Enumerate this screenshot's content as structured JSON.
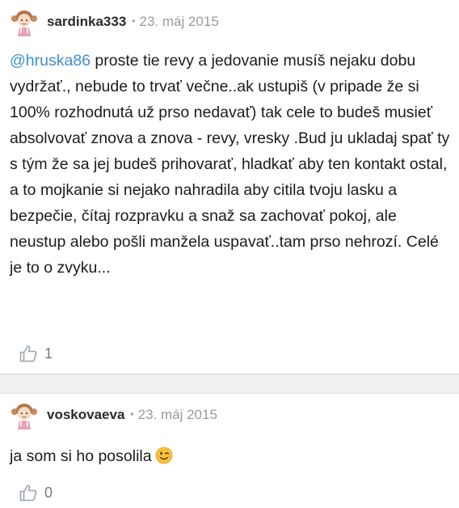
{
  "comments": [
    {
      "author": "sardinka333",
      "separator": "•",
      "date": "23. máj 2015",
      "mention": "@hruska86",
      "text": " proste tie revy a jedovanie musíš nejaku dobu vydržať., nebude to trvať večne..ak ustupiš (v pripade že si 100% rozhodnutá už prso nedavať) tak cele to budeš musieť absolvovať znova a znova - revy, vresky .Bud ju ukladaj spať ty s tým že sa jej budeš prihovarať, hladkať aby ten kontakt ostal, a to mojkanie si nejako nahradila aby citila tvoju lasku a bezpečie, čítaj rozpravku a snaž sa zachovať pokoj, ale neustup alebo pošli manžela uspavať..tam prso nehrozí. Celé je to o zvyku...",
      "likes": "1",
      "like_icon": "thumbs-up-icon",
      "avatar_icon": "girl-avatar-icon"
    },
    {
      "author": "voskovaeva",
      "separator": "•",
      "date": "23. máj 2015",
      "text": "ja som si ho posolila",
      "emoji": "winking-face-emoji",
      "likes": "0",
      "like_icon": "thumbs-up-icon",
      "avatar_icon": "girl-avatar-icon"
    }
  ],
  "colors": {
    "mention": "#3f8fd4",
    "author": "#2b2b2b",
    "meta": "#9a9a9a",
    "divider": "#f0f0f2"
  }
}
